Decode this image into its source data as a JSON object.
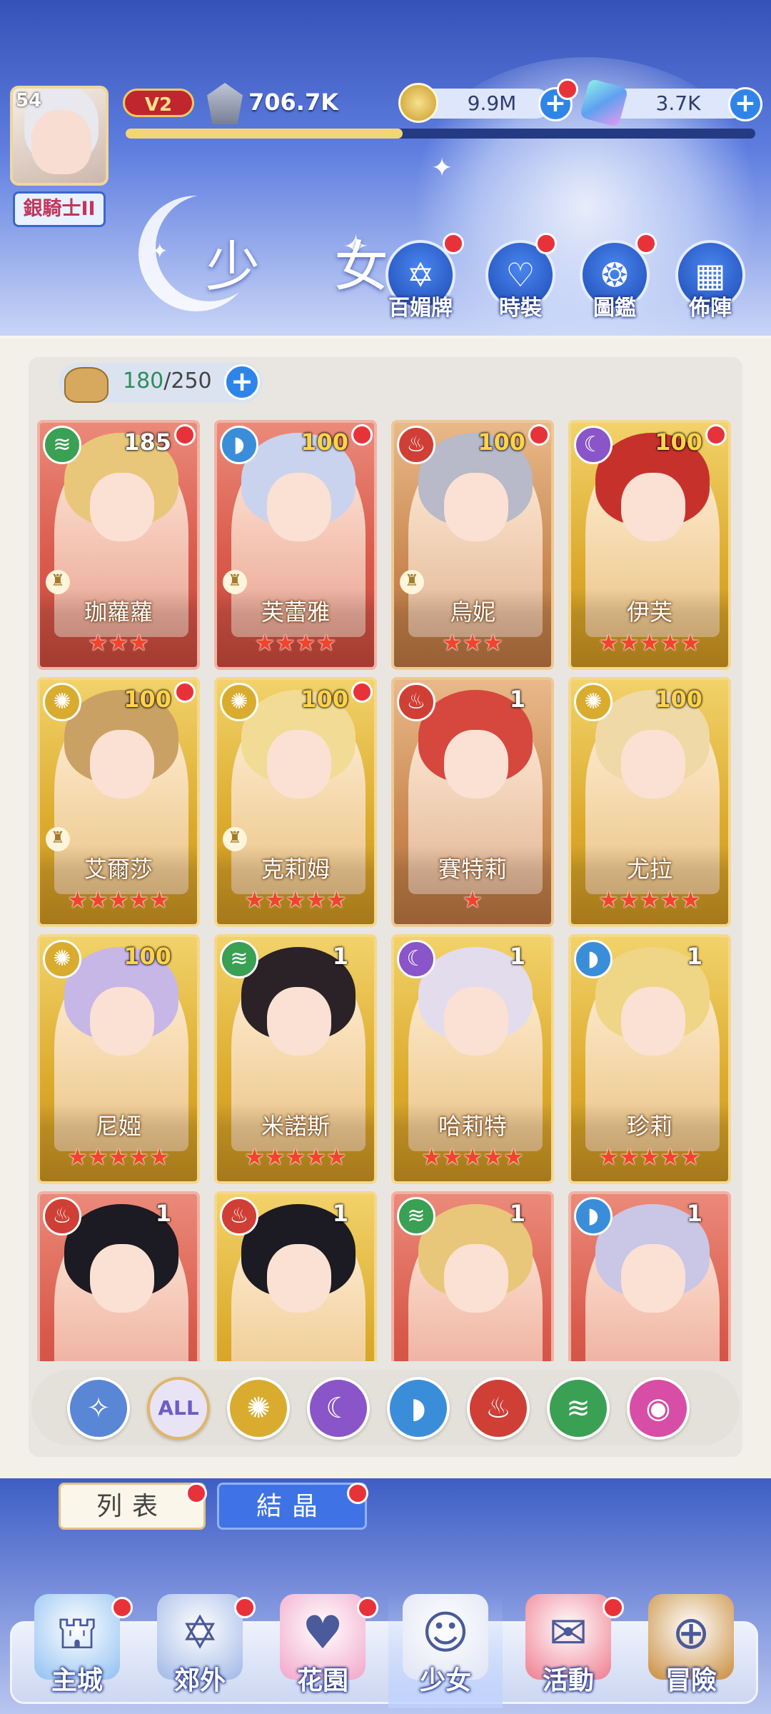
{
  "header": {
    "player_level": "54",
    "player_rank": "銀騎士II",
    "vip": "V2",
    "power": "706.7K",
    "gold": "9.9M",
    "gems": "3.7K",
    "xp_fraction": 0.44
  },
  "page_title": "少 女",
  "quick_actions": [
    {
      "label": "百媚牌",
      "icon": "card-icon"
    },
    {
      "label": "時裝",
      "icon": "outfit-icon"
    },
    {
      "label": "圖鑑",
      "icon": "book-icon"
    },
    {
      "label": "佈陣",
      "icon": "formation-grid-icon"
    }
  ],
  "capacity": {
    "current": "180",
    "max": "/250"
  },
  "characters": [
    {
      "name": "珈蘿蘿",
      "level": "185",
      "stars": "★★★",
      "tier": "red",
      "element": "wind",
      "hair": "#e8c77a"
    },
    {
      "name": "芙蕾雅",
      "level": "100",
      "stars": "★★★★",
      "tier": "red",
      "element": "water",
      "hair": "#c9d3ee"
    },
    {
      "name": "烏妮",
      "level": "100",
      "stars": "★★★",
      "tier": "copper",
      "element": "fire",
      "hair": "#b8b9c9"
    },
    {
      "name": "伊芙",
      "level": "100",
      "stars": "★★★★★",
      "tier": "gold",
      "element": "moon",
      "hair": "#c7312c"
    },
    {
      "name": "艾爾莎",
      "level": "100",
      "stars": "★★★★★",
      "tier": "gold",
      "element": "sun",
      "hair": "#caa165"
    },
    {
      "name": "克莉姆",
      "level": "100",
      "stars": "★★★★★",
      "tier": "gold",
      "element": "sun",
      "hair": "#f2dc95"
    },
    {
      "name": "賽特莉",
      "level": "1",
      "stars": "★",
      "tier": "copper",
      "element": "fire",
      "hair": "#d6473e"
    },
    {
      "name": "尤拉",
      "level": "100",
      "stars": "★★★★★",
      "tier": "gold",
      "element": "sun",
      "hair": "#efd9a6"
    },
    {
      "name": "尼婭",
      "level": "100",
      "stars": "★★★★★",
      "tier": "gold",
      "element": "sun",
      "hair": "#c6b7e7"
    },
    {
      "name": "米諾斯",
      "level": "1",
      "stars": "★★★★★",
      "tier": "gold",
      "element": "wind",
      "hair": "#2a2226"
    },
    {
      "name": "哈莉特",
      "level": "1",
      "stars": "★★★★★",
      "tier": "gold",
      "element": "moon",
      "hair": "#e3dced"
    },
    {
      "name": "珍莉",
      "level": "1",
      "stars": "★★★★★",
      "tier": "gold",
      "element": "water",
      "hair": "#efd586"
    },
    {
      "name": "",
      "level": "1",
      "stars": "",
      "tier": "red",
      "element": "fire",
      "hair": "#1c1a22"
    },
    {
      "name": "",
      "level": "1",
      "stars": "",
      "tier": "gold",
      "element": "fire",
      "hair": "#1c1a22"
    },
    {
      "name": "",
      "level": "1",
      "stars": "",
      "tier": "red",
      "element": "wind",
      "hair": "#e8c77a"
    },
    {
      "name": "",
      "level": "1",
      "stars": "",
      "tier": "red",
      "element": "water",
      "hair": "#c9c6e6"
    }
  ],
  "filters": [
    {
      "id": "special",
      "label": "",
      "color": "#5a86d6"
    },
    {
      "id": "all",
      "label": "ALL",
      "color": "#e9e3f6"
    },
    {
      "id": "sun",
      "label": "",
      "color": "#d9ac2f"
    },
    {
      "id": "moon",
      "label": "",
      "color": "#8a55c8"
    },
    {
      "id": "water",
      "label": "",
      "color": "#3a8ed9"
    },
    {
      "id": "fire",
      "label": "",
      "color": "#cf3f35"
    },
    {
      "id": "wind",
      "label": "",
      "color": "#3aa053"
    },
    {
      "id": "charm",
      "label": "",
      "color": "#d84da5"
    }
  ],
  "subtabs": {
    "list": "列表",
    "crystal": "結晶"
  },
  "bottom_nav": [
    {
      "label": "主城",
      "icon": "castle-icon"
    },
    {
      "label": "郊外",
      "icon": "portal-icon"
    },
    {
      "label": "花園",
      "icon": "heart-icon"
    },
    {
      "label": "少女",
      "icon": "girl-icon"
    },
    {
      "label": "活動",
      "icon": "gift-icon"
    },
    {
      "label": "冒險",
      "icon": "compass-icon"
    }
  ]
}
